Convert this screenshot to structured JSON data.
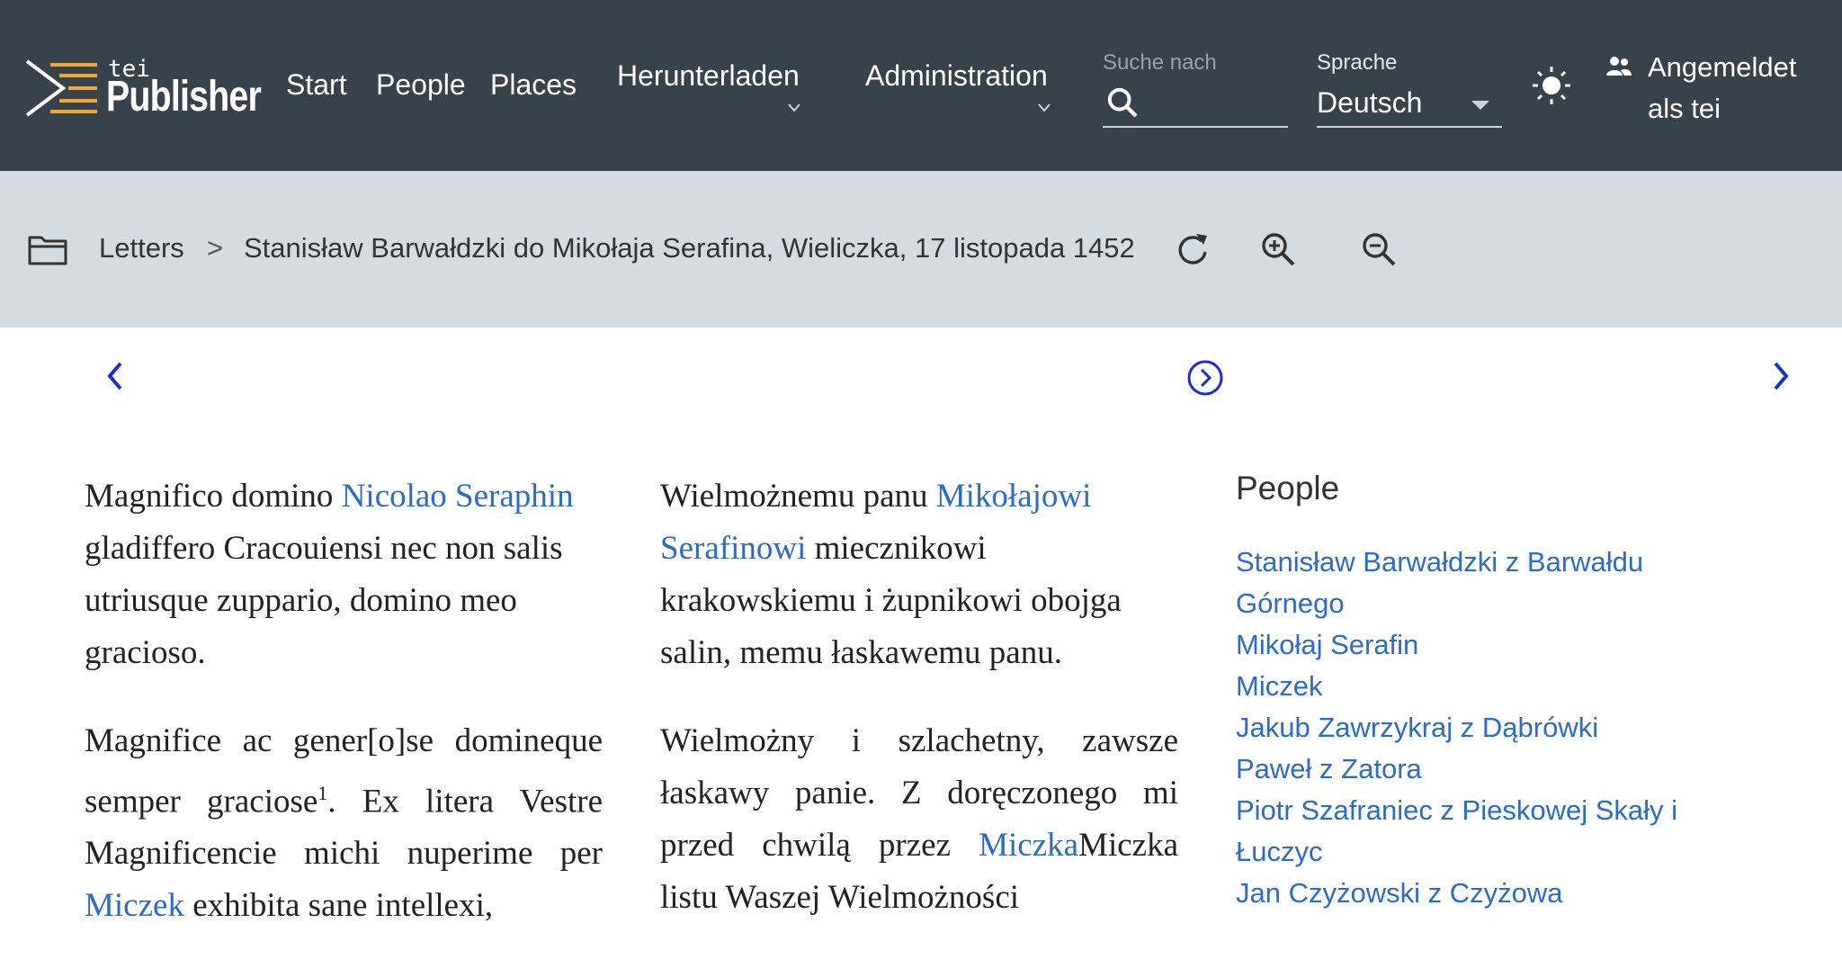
{
  "header": {
    "logo_small": "tei",
    "logo_large": "Publisher",
    "nav": [
      {
        "label": "Start"
      },
      {
        "label": "People"
      },
      {
        "label": "Places"
      },
      {
        "label": "Herunterladen"
      },
      {
        "label": "Administration"
      }
    ],
    "search": {
      "label": "Suche nach",
      "placeholder": ""
    },
    "language": {
      "label": "Sprache",
      "value": "Deutsch"
    },
    "user": {
      "label": "Angemeldet als tei"
    }
  },
  "breadcrumb": {
    "root": "Letters",
    "separator": ">",
    "current": "Stanisław Barwałdzki do Mikołaja Serafina, Wieliczka, 17 listopada 1452"
  },
  "latin": {
    "p1_text_before": "Magnifico domino ",
    "p1_link": "Nicolao Seraphin",
    "p1_text_after": " gladiffero Cracouiensi nec non salis utriusque zuppario, domino meo gracioso.",
    "p2_text_before": "Magnifice ac gener[o]se domineque semper graciose",
    "p2_note": "1",
    "p2_text_mid": ". Ex litera Vestre Magnificencie michi nuperime per ",
    "p2_link": "Miczek",
    "p2_text_after": " exhibita sane intellexi,"
  },
  "polish": {
    "p1_text_before": "Wielmożnemu panu ",
    "p1_link": "Mikołajowi Serafinowi",
    "p1_text_after": " miecznikowi krakowskiemu i żupnikowi obojga salin, memu łaskawemu panu.",
    "p2_text_before": "Wielmożny i szlachetny, zawsze łaskawy panie. Z doręczonego mi przed chwilą przez ",
    "p2_link": "Miczka",
    "p2_text_after": "Miczka listu Waszej Wielmożności"
  },
  "sidebar": {
    "title": "People",
    "people": [
      "Stanisław Barwałdzki z Barwałdu Górnego",
      "Mikołaj Serafin",
      "Miczek",
      "Jakub Zawrzykraj z Dąbrówki",
      "Paweł z Zatora",
      "Piotr Szafraniec z Pieskowej Skały i Łuczyc",
      "Jan Czyżowski z Czyżowa"
    ]
  },
  "colors": {
    "header_bg": "#38424b",
    "toolbar_bg": "#d4dbe1",
    "link": "#2e6bc4",
    "nav_arrow": "#1a2fd0",
    "logo_accent": "#f0a73a"
  },
  "icons": [
    "folder-icon",
    "refresh-icon",
    "zoom-in-icon",
    "zoom-out-icon",
    "search-icon",
    "theme-sun-icon",
    "user-group-icon",
    "chevron-down-icon",
    "previous-arrow-icon",
    "next-arrow-icon",
    "circle-arrow-icon"
  ]
}
